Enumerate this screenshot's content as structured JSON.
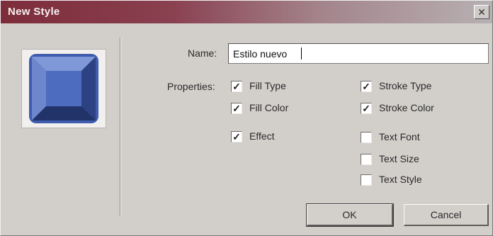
{
  "window": {
    "title": "New Style",
    "close_glyph": "✕"
  },
  "preview": {
    "icon": "bevel-square-icon",
    "color": "#4a67b8"
  },
  "name_field": {
    "label": "Name:",
    "value": "Estilo nuevo"
  },
  "properties_label": "Properties:",
  "checkboxes": {
    "fill_type": {
      "label": "Fill Type",
      "checked": true
    },
    "fill_color": {
      "label": "Fill Color",
      "checked": true
    },
    "effect": {
      "label": "Effect",
      "checked": true
    },
    "stroke_type": {
      "label": "Stroke Type",
      "checked": true
    },
    "stroke_color": {
      "label": "Stroke Color",
      "checked": true
    },
    "text_font": {
      "label": "Text Font",
      "checked": false
    },
    "text_size": {
      "label": "Text Size",
      "checked": false
    },
    "text_style": {
      "label": "Text Style",
      "checked": false
    }
  },
  "check_glyph": "✓",
  "buttons": {
    "ok": "OK",
    "cancel": "Cancel"
  }
}
